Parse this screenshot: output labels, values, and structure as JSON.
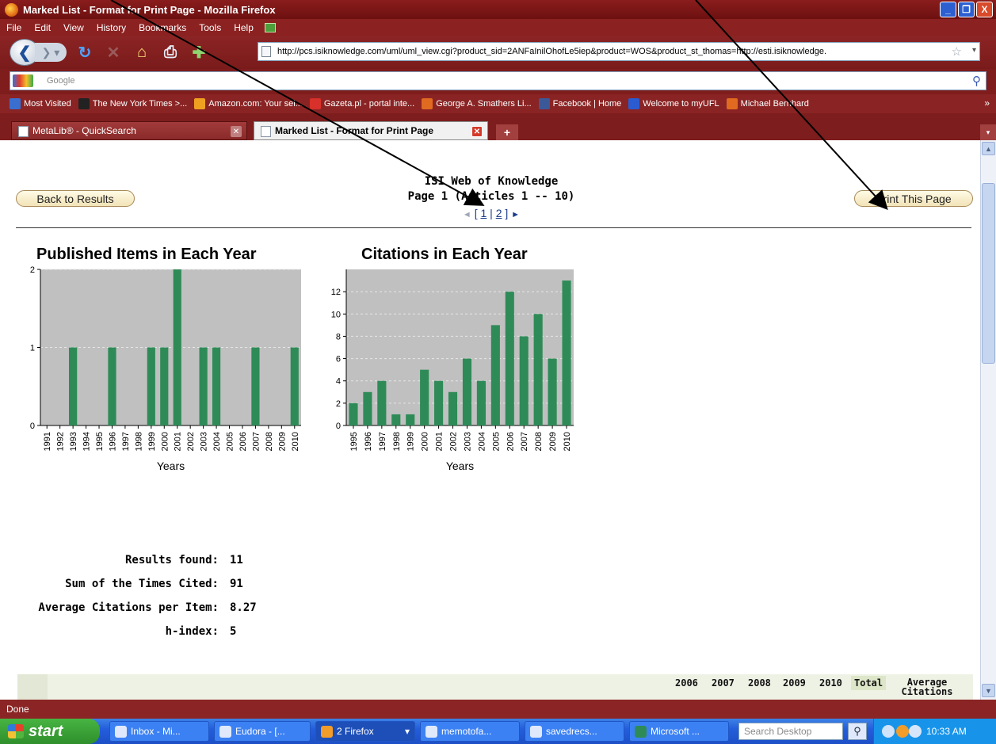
{
  "window": {
    "title": "Marked List - Format for Print Page - Mozilla Firefox",
    "buttons": [
      "_",
      "❐",
      "X"
    ]
  },
  "menu": [
    "File",
    "Edit",
    "View",
    "History",
    "Bookmarks",
    "Tools",
    "Help"
  ],
  "nav": {
    "url": "http://pcs.isiknowledge.com/uml/uml_view.cgi?product_sid=2ANFaInilOhofLe5iep&product=WOS&product_st_thomas=http://esti.isiknowledge."
  },
  "search": {
    "placeholder": "Google"
  },
  "bookmarks": [
    {
      "label": "Most Visited",
      "color": "#3a6fd0"
    },
    {
      "label": "The New York Times >...",
      "color": "#222222"
    },
    {
      "label": "Amazon.com: Your sel...",
      "color": "#f0a020"
    },
    {
      "label": "Gazeta.pl - portal inte...",
      "color": "#d8302a"
    },
    {
      "label": "George A. Smathers Li...",
      "color": "#e06a20"
    },
    {
      "label": "Facebook | Home",
      "color": "#3b5998"
    },
    {
      "label": "Welcome to myUFL",
      "color": "#2a5bd0"
    },
    {
      "label": "Michael Bernhard",
      "color": "#e06a20"
    }
  ],
  "tabs": [
    {
      "label": "MetaLib® - QuickSearch"
    },
    {
      "label": "Marked List - Format for Print Page"
    }
  ],
  "page": {
    "back_button": "Back to Results",
    "print_button": "Print This Page",
    "header_line1": "ISI Web of Knowledge",
    "header_line2": "Page 1 (Articles 1 -- 10)",
    "pager_prev": "◄",
    "pager_open": "[",
    "pager_page1": "1",
    "pager_sep": "|",
    "pager_page2": "2",
    "pager_close": "]",
    "pager_next": "►"
  },
  "chart_data": [
    {
      "type": "bar",
      "title": "Published Items in Each Year",
      "xlabel": "Years",
      "ylabel": "",
      "ylim": [
        0,
        2
      ],
      "yticks": [
        0,
        1,
        2
      ],
      "grid": true,
      "bar_color": "#2e8b57",
      "plot_bg": "#c0c0c0",
      "categories": [
        "1991",
        "1992",
        "1993",
        "1994",
        "1995",
        "1996",
        "1997",
        "1998",
        "1999",
        "2000",
        "2001",
        "2002",
        "2003",
        "2004",
        "2005",
        "2006",
        "2007",
        "2008",
        "2009",
        "2010"
      ],
      "values": [
        0,
        0,
        1,
        0,
        0,
        1,
        0,
        0,
        1,
        1,
        2,
        0,
        1,
        1,
        0,
        0,
        1,
        0,
        0,
        1
      ]
    },
    {
      "type": "bar",
      "title": "Citations in Each Year",
      "xlabel": "Years",
      "ylabel": "",
      "ylim": [
        0,
        14
      ],
      "yticks": [
        0,
        2,
        4,
        6,
        8,
        10,
        12
      ],
      "grid": true,
      "bar_color": "#2e8b57",
      "plot_bg": "#c0c0c0",
      "categories": [
        "1995",
        "1996",
        "1997",
        "1998",
        "1999",
        "2000",
        "2001",
        "2002",
        "2003",
        "2004",
        "2005",
        "2006",
        "2007",
        "2008",
        "2009",
        "2010"
      ],
      "values": [
        2,
        3,
        4,
        1,
        1,
        5,
        4,
        3,
        6,
        4,
        9,
        12,
        8,
        10,
        6,
        13
      ]
    }
  ],
  "stats": [
    {
      "label": "Results found:",
      "value": "11"
    },
    {
      "label": "Sum of the Times Cited:",
      "value": "91"
    },
    {
      "label": "Average Citations per Item:",
      "value": "8.27"
    },
    {
      "label": "h-index:",
      "value": "5"
    }
  ],
  "table_headers": {
    "years": [
      "2006",
      "2007",
      "2008",
      "2009",
      "2010"
    ],
    "total": "Total",
    "avg_line1": "Average",
    "avg_line2": "Citations"
  },
  "status": "Done",
  "taskbar": {
    "start": "start",
    "tasks": [
      "Inbox - Mi...",
      "Eudora - [...",
      "2 Firefox",
      "memotofa...",
      "savedrecs...",
      "Microsoft ..."
    ],
    "search_placeholder": "Search Desktop",
    "clock": "10:33 AM"
  }
}
